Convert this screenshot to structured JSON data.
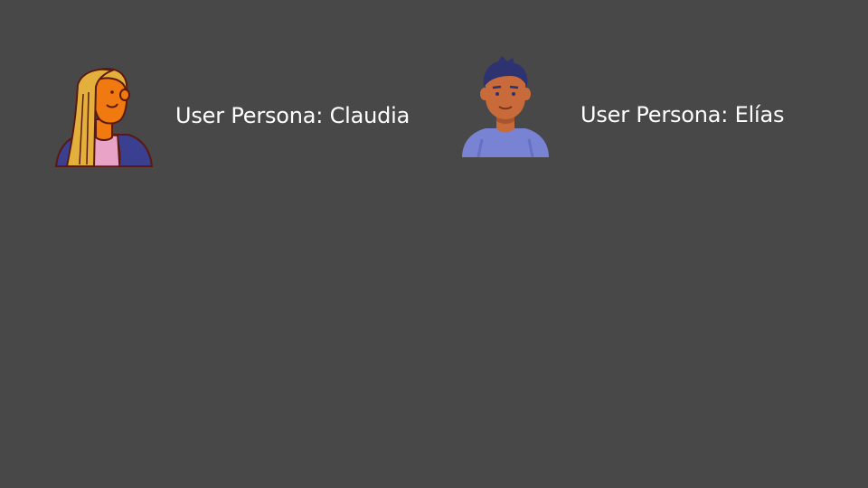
{
  "slide": {
    "background": "#484848"
  },
  "personas": [
    {
      "label": "User Persona: Claudia",
      "avatar_icon": "woman-avatar-icon"
    },
    {
      "label": "User Persona: Elías",
      "avatar_icon": "man-avatar-icon"
    }
  ]
}
